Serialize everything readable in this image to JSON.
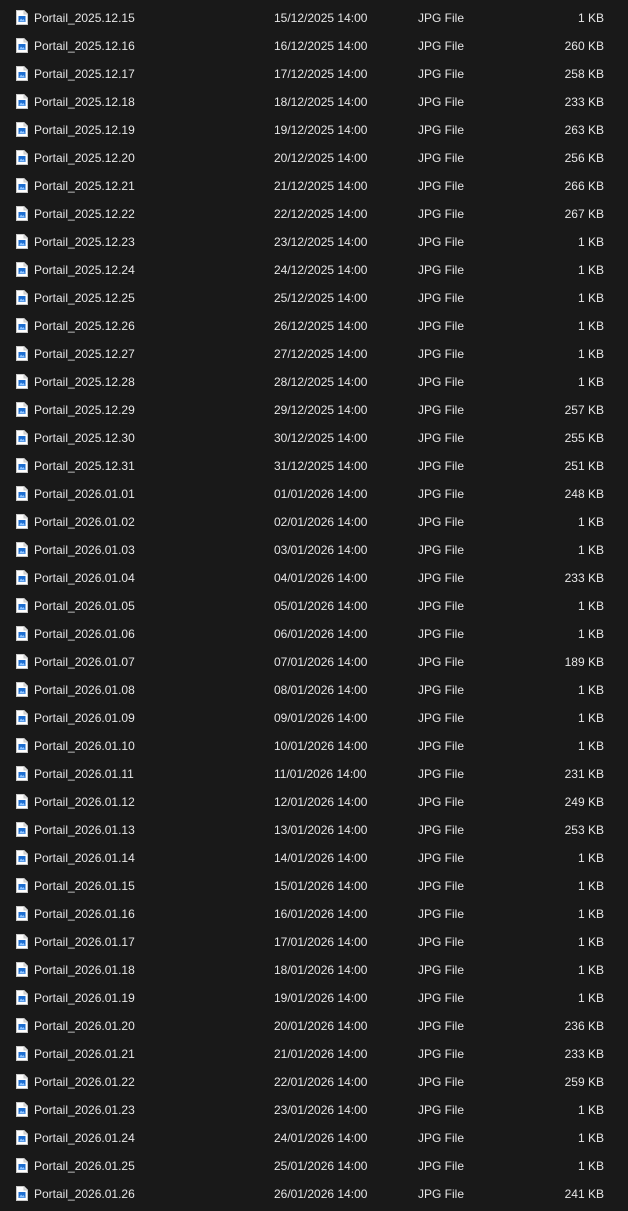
{
  "file_list": {
    "icon": "jpg-file-icon",
    "rows": [
      {
        "name": "Portail_2025.12.15",
        "date": "15/12/2025 14:00",
        "type": "JPG File",
        "size": "1 KB"
      },
      {
        "name": "Portail_2025.12.16",
        "date": "16/12/2025 14:00",
        "type": "JPG File",
        "size": "260 KB"
      },
      {
        "name": "Portail_2025.12.17",
        "date": "17/12/2025 14:00",
        "type": "JPG File",
        "size": "258 KB"
      },
      {
        "name": "Portail_2025.12.18",
        "date": "18/12/2025 14:00",
        "type": "JPG File",
        "size": "233 KB"
      },
      {
        "name": "Portail_2025.12.19",
        "date": "19/12/2025 14:00",
        "type": "JPG File",
        "size": "263 KB"
      },
      {
        "name": "Portail_2025.12.20",
        "date": "20/12/2025 14:00",
        "type": "JPG File",
        "size": "256 KB"
      },
      {
        "name": "Portail_2025.12.21",
        "date": "21/12/2025 14:00",
        "type": "JPG File",
        "size": "266 KB"
      },
      {
        "name": "Portail_2025.12.22",
        "date": "22/12/2025 14:00",
        "type": "JPG File",
        "size": "267 KB"
      },
      {
        "name": "Portail_2025.12.23",
        "date": "23/12/2025 14:00",
        "type": "JPG File",
        "size": "1 KB"
      },
      {
        "name": "Portail_2025.12.24",
        "date": "24/12/2025 14:00",
        "type": "JPG File",
        "size": "1 KB"
      },
      {
        "name": "Portail_2025.12.25",
        "date": "25/12/2025 14:00",
        "type": "JPG File",
        "size": "1 KB"
      },
      {
        "name": "Portail_2025.12.26",
        "date": "26/12/2025 14:00",
        "type": "JPG File",
        "size": "1 KB"
      },
      {
        "name": "Portail_2025.12.27",
        "date": "27/12/2025 14:00",
        "type": "JPG File",
        "size": "1 KB"
      },
      {
        "name": "Portail_2025.12.28",
        "date": "28/12/2025 14:00",
        "type": "JPG File",
        "size": "1 KB"
      },
      {
        "name": "Portail_2025.12.29",
        "date": "29/12/2025 14:00",
        "type": "JPG File",
        "size": "257 KB"
      },
      {
        "name": "Portail_2025.12.30",
        "date": "30/12/2025 14:00",
        "type": "JPG File",
        "size": "255 KB"
      },
      {
        "name": "Portail_2025.12.31",
        "date": "31/12/2025 14:00",
        "type": "JPG File",
        "size": "251 KB"
      },
      {
        "name": "Portail_2026.01.01",
        "date": "01/01/2026 14:00",
        "type": "JPG File",
        "size": "248 KB"
      },
      {
        "name": "Portail_2026.01.02",
        "date": "02/01/2026 14:00",
        "type": "JPG File",
        "size": "1 KB"
      },
      {
        "name": "Portail_2026.01.03",
        "date": "03/01/2026 14:00",
        "type": "JPG File",
        "size": "1 KB"
      },
      {
        "name": "Portail_2026.01.04",
        "date": "04/01/2026 14:00",
        "type": "JPG File",
        "size": "233 KB"
      },
      {
        "name": "Portail_2026.01.05",
        "date": "05/01/2026 14:00",
        "type": "JPG File",
        "size": "1 KB"
      },
      {
        "name": "Portail_2026.01.06",
        "date": "06/01/2026 14:00",
        "type": "JPG File",
        "size": "1 KB"
      },
      {
        "name": "Portail_2026.01.07",
        "date": "07/01/2026 14:00",
        "type": "JPG File",
        "size": "189 KB"
      },
      {
        "name": "Portail_2026.01.08",
        "date": "08/01/2026 14:00",
        "type": "JPG File",
        "size": "1 KB"
      },
      {
        "name": "Portail_2026.01.09",
        "date": "09/01/2026 14:00",
        "type": "JPG File",
        "size": "1 KB"
      },
      {
        "name": "Portail_2026.01.10",
        "date": "10/01/2026 14:00",
        "type": "JPG File",
        "size": "1 KB"
      },
      {
        "name": "Portail_2026.01.11",
        "date": "11/01/2026 14:00",
        "type": "JPG File",
        "size": "231 KB"
      },
      {
        "name": "Portail_2026.01.12",
        "date": "12/01/2026 14:00",
        "type": "JPG File",
        "size": "249 KB"
      },
      {
        "name": "Portail_2026.01.13",
        "date": "13/01/2026 14:00",
        "type": "JPG File",
        "size": "253 KB"
      },
      {
        "name": "Portail_2026.01.14",
        "date": "14/01/2026 14:00",
        "type": "JPG File",
        "size": "1 KB"
      },
      {
        "name": "Portail_2026.01.15",
        "date": "15/01/2026 14:00",
        "type": "JPG File",
        "size": "1 KB"
      },
      {
        "name": "Portail_2026.01.16",
        "date": "16/01/2026 14:00",
        "type": "JPG File",
        "size": "1 KB"
      },
      {
        "name": "Portail_2026.01.17",
        "date": "17/01/2026 14:00",
        "type": "JPG File",
        "size": "1 KB"
      },
      {
        "name": "Portail_2026.01.18",
        "date": "18/01/2026 14:00",
        "type": "JPG File",
        "size": "1 KB"
      },
      {
        "name": "Portail_2026.01.19",
        "date": "19/01/2026 14:00",
        "type": "JPG File",
        "size": "1 KB"
      },
      {
        "name": "Portail_2026.01.20",
        "date": "20/01/2026 14:00",
        "type": "JPG File",
        "size": "236 KB"
      },
      {
        "name": "Portail_2026.01.21",
        "date": "21/01/2026 14:00",
        "type": "JPG File",
        "size": "233 KB"
      },
      {
        "name": "Portail_2026.01.22",
        "date": "22/01/2026 14:00",
        "type": "JPG File",
        "size": "259 KB"
      },
      {
        "name": "Portail_2026.01.23",
        "date": "23/01/2026 14:00",
        "type": "JPG File",
        "size": "1 KB"
      },
      {
        "name": "Portail_2026.01.24",
        "date": "24/01/2026 14:00",
        "type": "JPG File",
        "size": "1 KB"
      },
      {
        "name": "Portail_2026.01.25",
        "date": "25/01/2026 14:00",
        "type": "JPG File",
        "size": "1 KB"
      },
      {
        "name": "Portail_2026.01.26",
        "date": "26/01/2026 14:00",
        "type": "JPG File",
        "size": "241 KB"
      }
    ]
  },
  "colors": {
    "background": "#191919",
    "text": "#e6e6e6",
    "icon_accent": "#1f6fd1"
  }
}
